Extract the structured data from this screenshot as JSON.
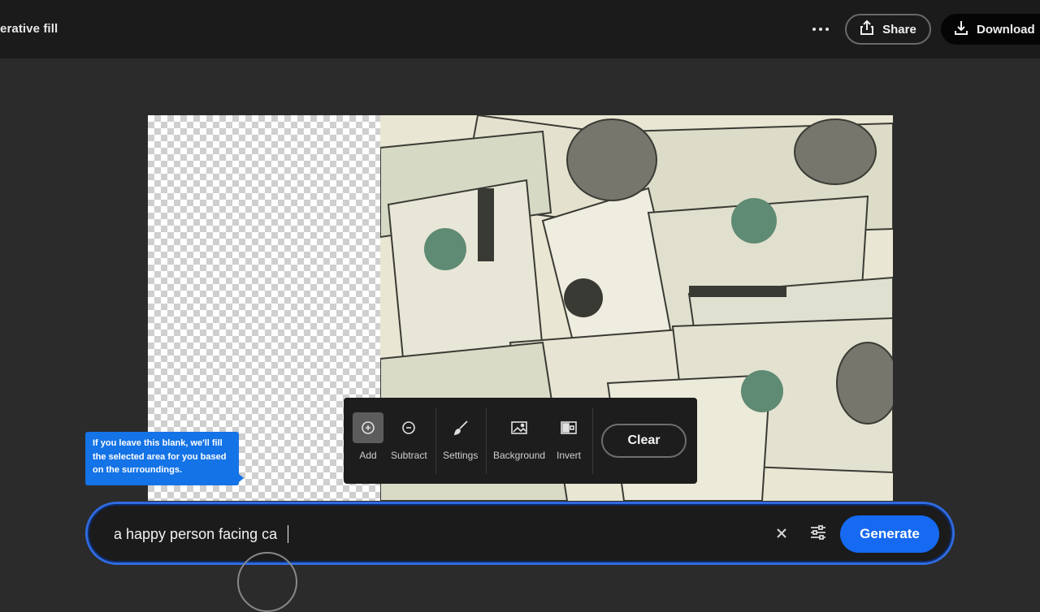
{
  "header": {
    "app_title": "erative fill",
    "more_icon": "more-horizontal-icon",
    "share_label": "Share",
    "share_icon": "share-icon",
    "download_label": "Download",
    "download_icon": "download-icon"
  },
  "canvas": {
    "image_subject": "scattered hundred-dollar bills",
    "transparent_region": "checkerboard"
  },
  "tooltip": {
    "text": "If you leave this blank, we'll fill the selected area for you based on the surroundings."
  },
  "toolbar": {
    "tools": [
      {
        "label": "Add",
        "icon": "add-circle-icon",
        "active": true
      },
      {
        "label": "Subtract",
        "icon": "subtract-circle-icon",
        "active": false
      },
      {
        "label": "Settings",
        "icon": "brush-icon",
        "active": false
      },
      {
        "label": "Background",
        "icon": "image-icon",
        "active": false
      },
      {
        "label": "Invert",
        "icon": "invert-icon",
        "active": false
      }
    ],
    "clear_label": "Clear"
  },
  "prompt": {
    "value": "a happy person facing ca",
    "clear_icon": "close-icon",
    "settings_icon": "sliders-icon",
    "generate_label": "Generate"
  },
  "colors": {
    "accent": "#1669f1",
    "tooltip": "#1473e6",
    "topbar": "#1b1b1b",
    "background": "#2b2b2b"
  }
}
